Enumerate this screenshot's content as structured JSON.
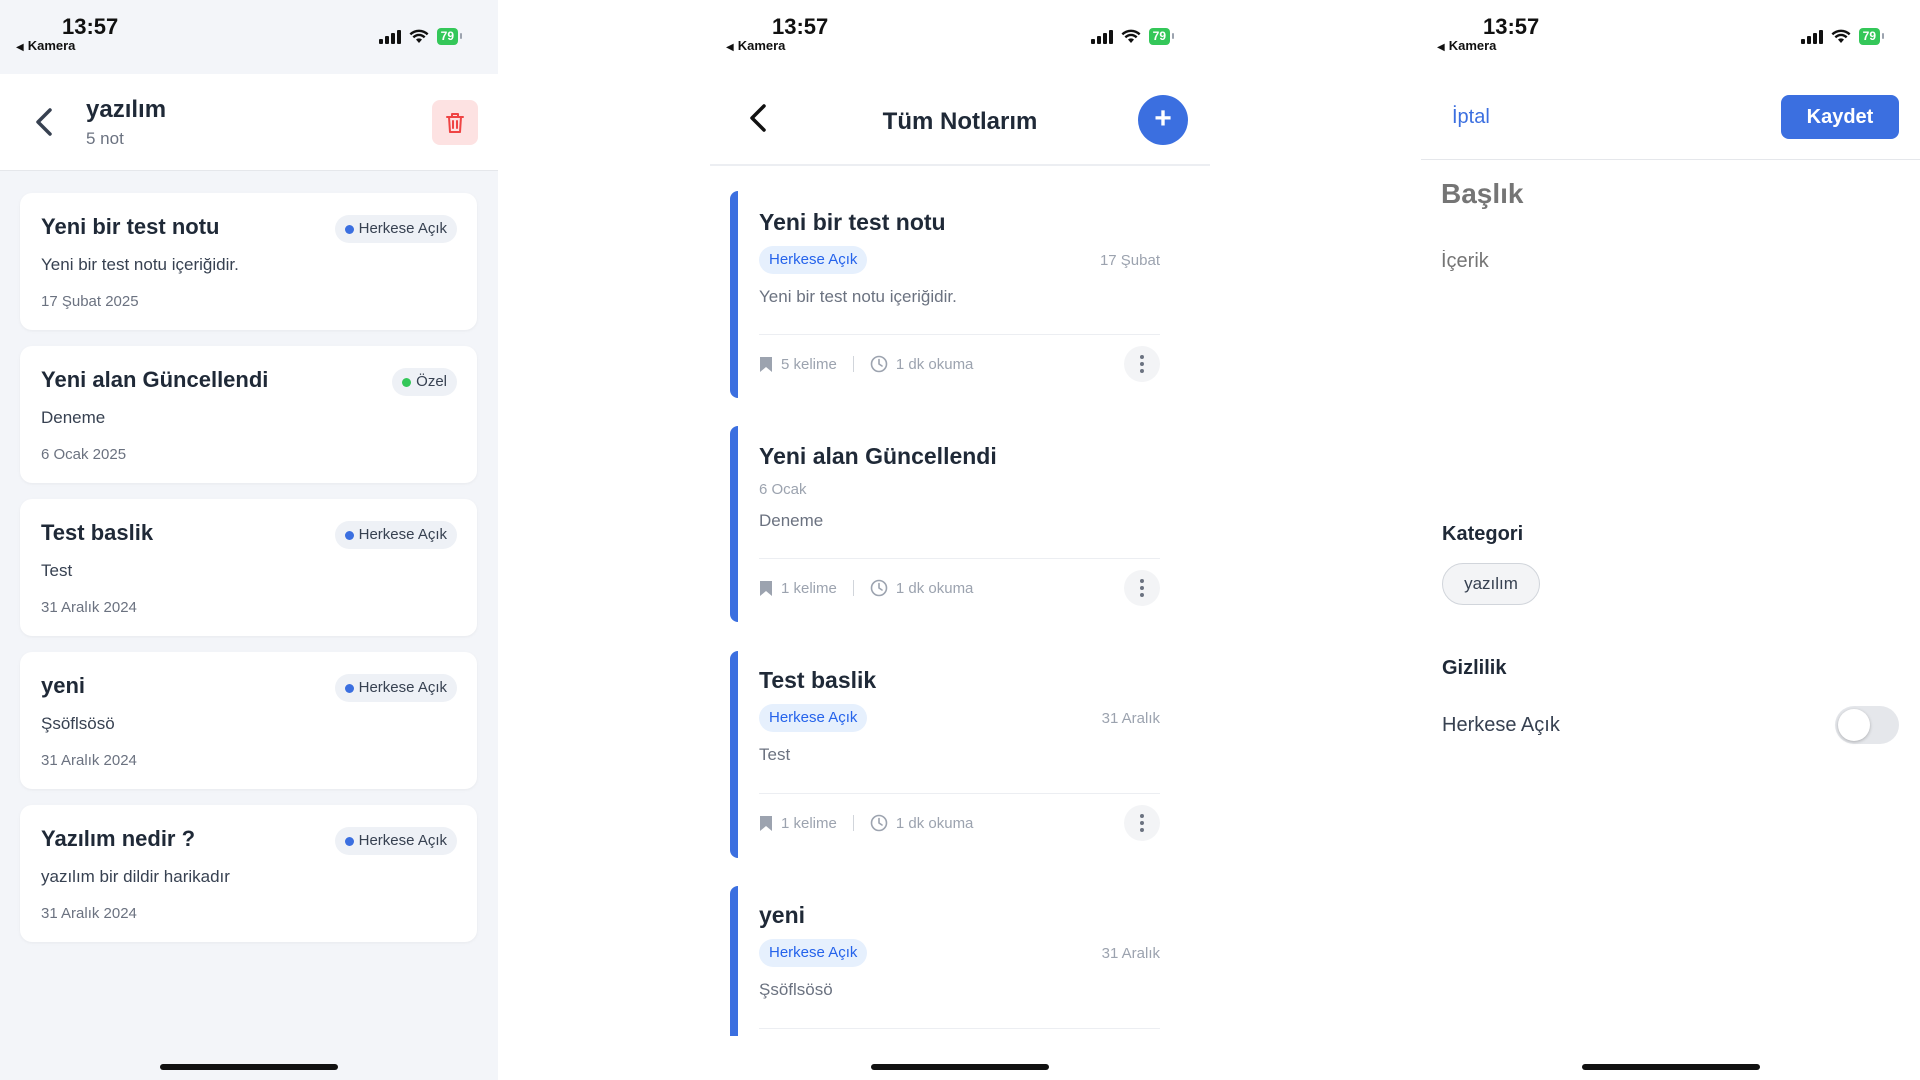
{
  "status_bar": {
    "time": "13:57",
    "back_app": "Kamera",
    "battery": "79"
  },
  "colors": {
    "accent": "#3b6fe0",
    "private_dot": "#34c759",
    "public_dot": "#3b6fe0",
    "danger_bg": "#fde2e2",
    "danger": "#ef4444"
  },
  "category_screen": {
    "title": "yazılım",
    "subtitle": "5 not",
    "notes": [
      {
        "title": "Yeni bir test notu",
        "body": "Yeni bir test notu içeriğidir.",
        "date": "17 Şubat 2025",
        "badge": "Herkese Açık",
        "visibility": "public"
      },
      {
        "title": "Yeni alan Güncellendi",
        "body": "Deneme",
        "date": "6 Ocak 2025",
        "badge": "Özel",
        "visibility": "private"
      },
      {
        "title": "Test baslik",
        "body": "Test",
        "date": "31 Aralık 2024",
        "badge": "Herkese Açık",
        "visibility": "public"
      },
      {
        "title": "yeni",
        "body": "Şsöflsösö",
        "date": "31 Aralık 2024",
        "badge": "Herkese Açık",
        "visibility": "public"
      },
      {
        "title": "Yazılım nedir ?",
        "body": "yazılım bir dildir harikadır",
        "date": "31 Aralık 2024",
        "badge": "Herkese Açık",
        "visibility": "public"
      }
    ]
  },
  "notes_screen": {
    "title": "Tüm Notlarım",
    "add_label": "+",
    "notes": [
      {
        "title": "Yeni bir test notu",
        "tag": "Herkese Açık",
        "date": "17 Şubat",
        "body": "Yeni bir test notu içeriğidir.",
        "words": "5 kelime",
        "read": "1 dk okuma"
      },
      {
        "title": "Yeni alan Güncellendi",
        "tag": "",
        "date": "6 Ocak",
        "body": "Deneme",
        "words": "1 kelime",
        "read": "1 dk okuma"
      },
      {
        "title": "Test baslik",
        "tag": "Herkese Açık",
        "date": "31 Aralık",
        "body": "Test",
        "words": "1 kelime",
        "read": "1 dk okuma"
      },
      {
        "title": "yeni",
        "tag": "Herkese Açık",
        "date": "31 Aralık",
        "body": "Şsöflsösö",
        "words": "",
        "read": ""
      }
    ]
  },
  "editor_screen": {
    "cancel_label": "İptal",
    "save_label": "Kaydet",
    "title_placeholder": "Başlık",
    "content_placeholder": "İçerik",
    "category_label": "Kategori",
    "category_value": "yazılım",
    "privacy_label": "Gizlilik",
    "privacy_option": "Herkese Açık",
    "privacy_on": false
  }
}
